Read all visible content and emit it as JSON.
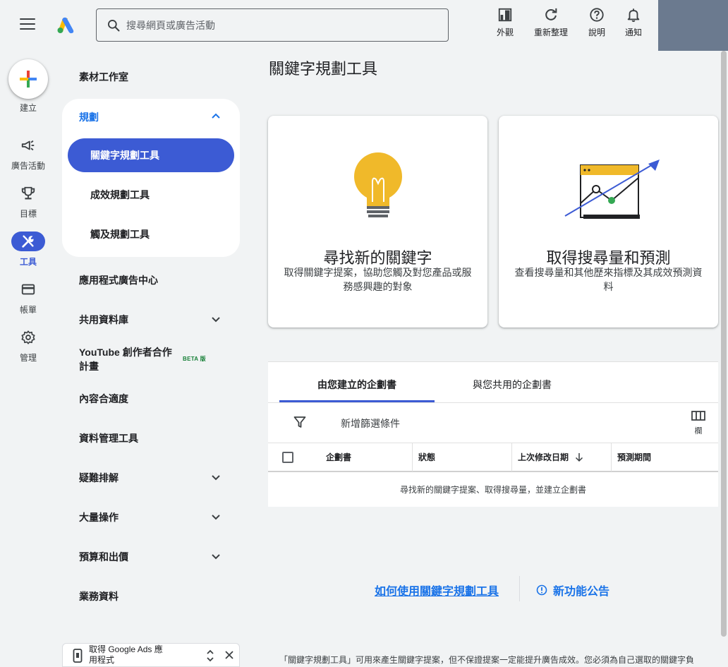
{
  "header": {
    "search_placeholder": "搜尋網頁或廣告活動",
    "actions": [
      {
        "label": "外觀",
        "icon": "appearance-icon"
      },
      {
        "label": "重新整理",
        "icon": "refresh-icon"
      },
      {
        "label": "說明",
        "icon": "help-icon"
      },
      {
        "label": "通知",
        "icon": "bell-icon"
      }
    ]
  },
  "rail": {
    "create_label": "建立",
    "items": [
      {
        "label": "廣告活動",
        "icon": "megaphone-icon"
      },
      {
        "label": "目標",
        "icon": "trophy-icon"
      },
      {
        "label": "工具",
        "icon": "tools-icon"
      },
      {
        "label": "帳單",
        "icon": "credit-card-icon"
      },
      {
        "label": "管理",
        "icon": "gear-icon"
      }
    ]
  },
  "nav": {
    "asset_studio": "素材工作室",
    "planning": {
      "label": "規劃",
      "items": [
        "關鍵字規劃工具",
        "成效規劃工具",
        "觸及規劃工具"
      ]
    },
    "app_ads_hub": "應用程式廣告中心",
    "shared_library": "共用資料庫",
    "youtube_partnership": "YouTube 創作者合作計畫",
    "beta": "BETA 版",
    "content_suitability": "內容合適度",
    "data_manager": "資料管理工具",
    "troubleshooting": "疑難排解",
    "bulk_actions": "大量操作",
    "budgets_bidding": "預算和出價",
    "business_data": "業務資料",
    "app_banner": "取得 Google Ads 應用程式"
  },
  "main": {
    "title": "關鍵字規劃工具",
    "card_discover": {
      "title": "尋找新的關鍵字",
      "desc": "取得關鍵字提案，協助您觸及對您產品或服務感興趣的對象"
    },
    "card_forecast": {
      "title": "取得搜尋量和預測",
      "desc": "查看搜尋量和其他歷來指標及其成效預測資料"
    },
    "tabs": [
      "由您建立的企劃書",
      "與您共用的企劃書"
    ],
    "add_filter": "新增篩選條件",
    "columns_label": "欄",
    "table_headers": [
      "企劃書",
      "狀態",
      "上次修改日期",
      "預測期間"
    ],
    "empty_message": "尋找新的關鍵字提案、取得搜尋量，並建立企劃書",
    "help_link": "如何使用關鍵字規劃工具",
    "news_link": "新功能公告",
    "disclaimer": "「關鍵字規劃工具」可用來產生關鍵字提案，但不保證提案一定能提升廣告成效。您必須為自己選取的關鍵字負"
  },
  "colors": {
    "accent": "#3c5bd4",
    "link": "#1a73e8",
    "bulb": "#f0b92a",
    "background": "#f1f3f4"
  }
}
